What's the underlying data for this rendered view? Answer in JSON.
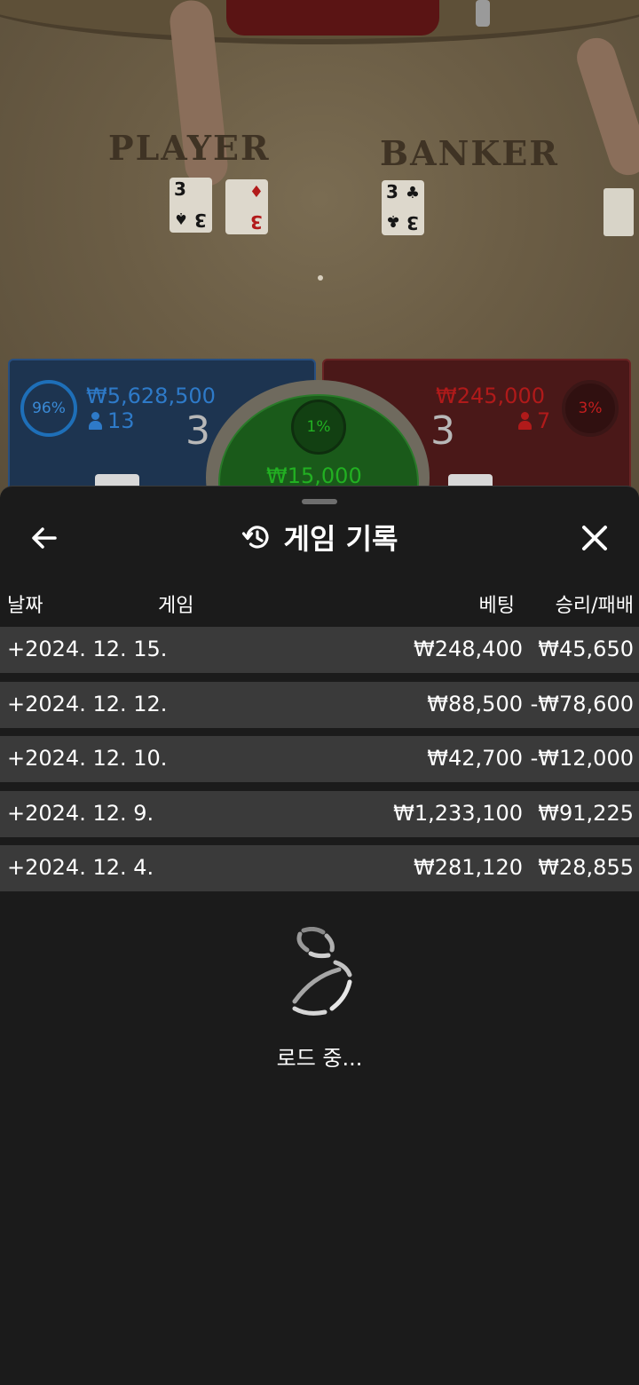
{
  "scene": {
    "player_label": "PLAYER",
    "banker_label": "BANKER",
    "player_cards": [
      {
        "rank": "3",
        "suit": "♠",
        "color": "black"
      },
      {
        "rank": "3",
        "suit": "♦",
        "color": "red"
      }
    ],
    "banker_cards": [
      {
        "rank": "3",
        "suit": "♣",
        "color": "black"
      }
    ],
    "player_panel": {
      "percent": "96%",
      "amount": "₩5,628,500",
      "players": "13",
      "score": "3"
    },
    "banker_panel": {
      "percent": "3%",
      "amount": "₩245,000",
      "players": "7",
      "score": "3"
    },
    "tie_panel": {
      "percent": "1%",
      "amount": "₩15,000"
    },
    "colors": {
      "player": "#1e6fb8",
      "banker": "#b01a1a",
      "tie": "#22b022"
    }
  },
  "sheet": {
    "title": "게임 기록",
    "back_icon": "arrow-left-icon",
    "close_icon": "close-icon",
    "history_icon": "history-icon",
    "columns": {
      "date": "날짜",
      "game": "게임",
      "bet": "베팅",
      "win_loss": "승리/패배"
    },
    "rows": [
      {
        "date": "+2024. 12. 15.",
        "bet": "₩248,400",
        "win_loss": "₩45,650"
      },
      {
        "date": "+2024. 12. 12.",
        "bet": "₩88,500",
        "win_loss": "-₩78,600"
      },
      {
        "date": "+2024. 12. 10.",
        "bet": "₩42,700",
        "win_loss": "-₩12,000"
      },
      {
        "date": "+2024. 12. 9.",
        "bet": "₩1,233,100",
        "win_loss": "₩91,225"
      },
      {
        "date": "+2024. 12. 4.",
        "bet": "₩281,120",
        "win_loss": "₩28,855"
      }
    ],
    "loading_text": "로드 중..."
  }
}
